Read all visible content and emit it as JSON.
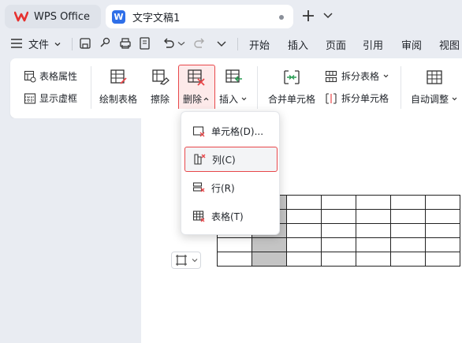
{
  "tabs": [
    {
      "label": "WPS Office"
    },
    {
      "label": "文字文稿1"
    }
  ],
  "menubar": {
    "file_label": "文件",
    "menus": [
      "开始",
      "插入",
      "页面",
      "引用",
      "审阅",
      "视图"
    ]
  },
  "ribbon": {
    "table_properties": "表格属性",
    "show_virtual_border": "显示虚框",
    "draw_table": "绘制表格",
    "erase": "擦除",
    "delete": "删除",
    "insert": "插入",
    "merge_cells": "合并单元格",
    "split_table": "拆分表格",
    "split_cells": "拆分单元格",
    "auto_adjust": "自动调整"
  },
  "delete_menu": {
    "items": [
      {
        "label": "单元格(D)...",
        "icon": "delete-cell-icon"
      },
      {
        "label": "列(C)",
        "icon": "delete-column-icon"
      },
      {
        "label": "行(R)",
        "icon": "delete-row-icon"
      },
      {
        "label": "表格(T)",
        "icon": "delete-table-icon"
      }
    ]
  },
  "colors": {
    "accent_red": "#e8474a",
    "wps_brand": "#e63230",
    "doc_blue": "#2f6fe8",
    "selected_cell": "#c4c4c4"
  }
}
